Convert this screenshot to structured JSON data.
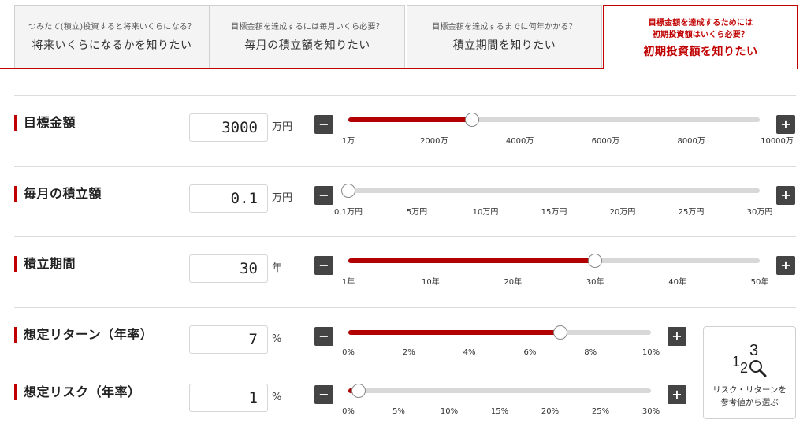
{
  "tabs": [
    {
      "sub": "つみたて(積立)投資すると将来いくらになる？",
      "sub2": "",
      "main": "将来いくらになるかを知りたい",
      "active": false
    },
    {
      "sub": "目標金額を達成するには毎月いくら必要？",
      "sub2": "",
      "main": "毎月の積立額を知りたい",
      "active": false
    },
    {
      "sub": "目標金額を達成するまでに何年かかる？",
      "sub2": "",
      "main": "積立期間を知りたい",
      "active": false
    },
    {
      "sub": "目標金額を達成するためには",
      "sub2": "初期投資額はいくら必要？",
      "main": "初期投資額を知りたい",
      "active": true
    }
  ],
  "rows": [
    {
      "label": "目標金額",
      "value": "3000",
      "unit": "万円",
      "minus": "−",
      "plus": "+",
      "slider_fraction": 0.3,
      "ticks": [
        "1万",
        "2000万",
        "4000万",
        "6000万",
        "8000万",
        "10000万"
      ]
    },
    {
      "label": "毎月の積立額",
      "value": "0.1",
      "unit": "万円",
      "minus": "−",
      "plus": "+",
      "slider_fraction": 0.0,
      "ticks": [
        "0.1万円",
        "5万円",
        "10万円",
        "15万円",
        "20万円",
        "25万円",
        "30万円"
      ]
    },
    {
      "label": "積立期間",
      "value": "30",
      "unit": "年",
      "minus": "−",
      "plus": "+",
      "slider_fraction": 0.6,
      "ticks": [
        "1年",
        "10年",
        "20年",
        "30年",
        "40年",
        "50年"
      ]
    },
    {
      "label": "想定リターン（年率）",
      "value": "7",
      "unit": "%",
      "minus": "−",
      "plus": "+",
      "slider_fraction": 0.7,
      "ticks": [
        "0%",
        "2%",
        "4%",
        "6%",
        "8%",
        "10%"
      ]
    },
    {
      "label": "想定リスク（年率）",
      "value": "1",
      "unit": "%",
      "minus": "−",
      "plus": "+",
      "slider_fraction": 0.0333,
      "ticks": [
        "0%",
        "5%",
        "10%",
        "15%",
        "20%",
        "25%",
        "30%"
      ]
    }
  ],
  "helper": {
    "line1": "リスク・リターンを",
    "line2": "参考値から選ぶ",
    "icon": "numbers-magnifier-icon"
  },
  "colors": {
    "accent": "#c00000",
    "fill": "#b30000",
    "button": "#444444",
    "track": "#d8d8d8"
  }
}
